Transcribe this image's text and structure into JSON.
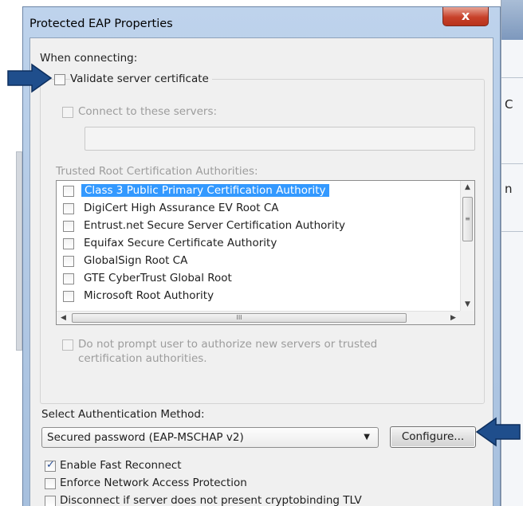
{
  "window": {
    "title": "Protected EAP Properties",
    "close_glyph": "x"
  },
  "background_fragments": {
    "frag1": "C",
    "frag2": "n"
  },
  "connecting": {
    "heading": "When connecting:",
    "validate_label": "Validate server certificate",
    "validate_checked": false,
    "connect_servers_label": "Connect to these servers:",
    "connect_servers_value": "",
    "trusted_heading": "Trusted Root Certification Authorities:",
    "authorities": [
      {
        "label": "Class 3 Public Primary Certification Authority",
        "checked": false,
        "selected": true
      },
      {
        "label": "DigiCert High Assurance EV Root CA",
        "checked": false,
        "selected": false
      },
      {
        "label": "Entrust.net Secure Server Certification Authority",
        "checked": false,
        "selected": false
      },
      {
        "label": "Equifax Secure Certificate Authority",
        "checked": false,
        "selected": false
      },
      {
        "label": "GlobalSign Root CA",
        "checked": false,
        "selected": false
      },
      {
        "label": "GTE CyberTrust Global Root",
        "checked": false,
        "selected": false
      },
      {
        "label": "Microsoft Root Authority",
        "checked": false,
        "selected": false
      }
    ],
    "scroll_up_glyph": "▲",
    "scroll_down_glyph": "▼",
    "scroll_left_glyph": "◀",
    "scroll_right_glyph": "▶",
    "thumb_grip_v": "≡",
    "thumb_grip_h": "III",
    "do_not_prompt_label_line1": "Do not prompt user to authorize new servers or trusted",
    "do_not_prompt_label_line2": "certification authorities."
  },
  "auth": {
    "heading": "Select Authentication Method:",
    "method_value": "Secured password (EAP-MSCHAP v2)",
    "dropdown_glyph": "▼",
    "configure_label": "Configure..."
  },
  "options": [
    {
      "label": "Enable Fast Reconnect",
      "checked": true
    },
    {
      "label": "Enforce Network Access Protection",
      "checked": false
    },
    {
      "label": "Disconnect if server does not present cryptobinding TLV",
      "checked": false
    }
  ],
  "colors": {
    "callout_arrow": "#1f4e8c",
    "selection": "#3399ff"
  }
}
